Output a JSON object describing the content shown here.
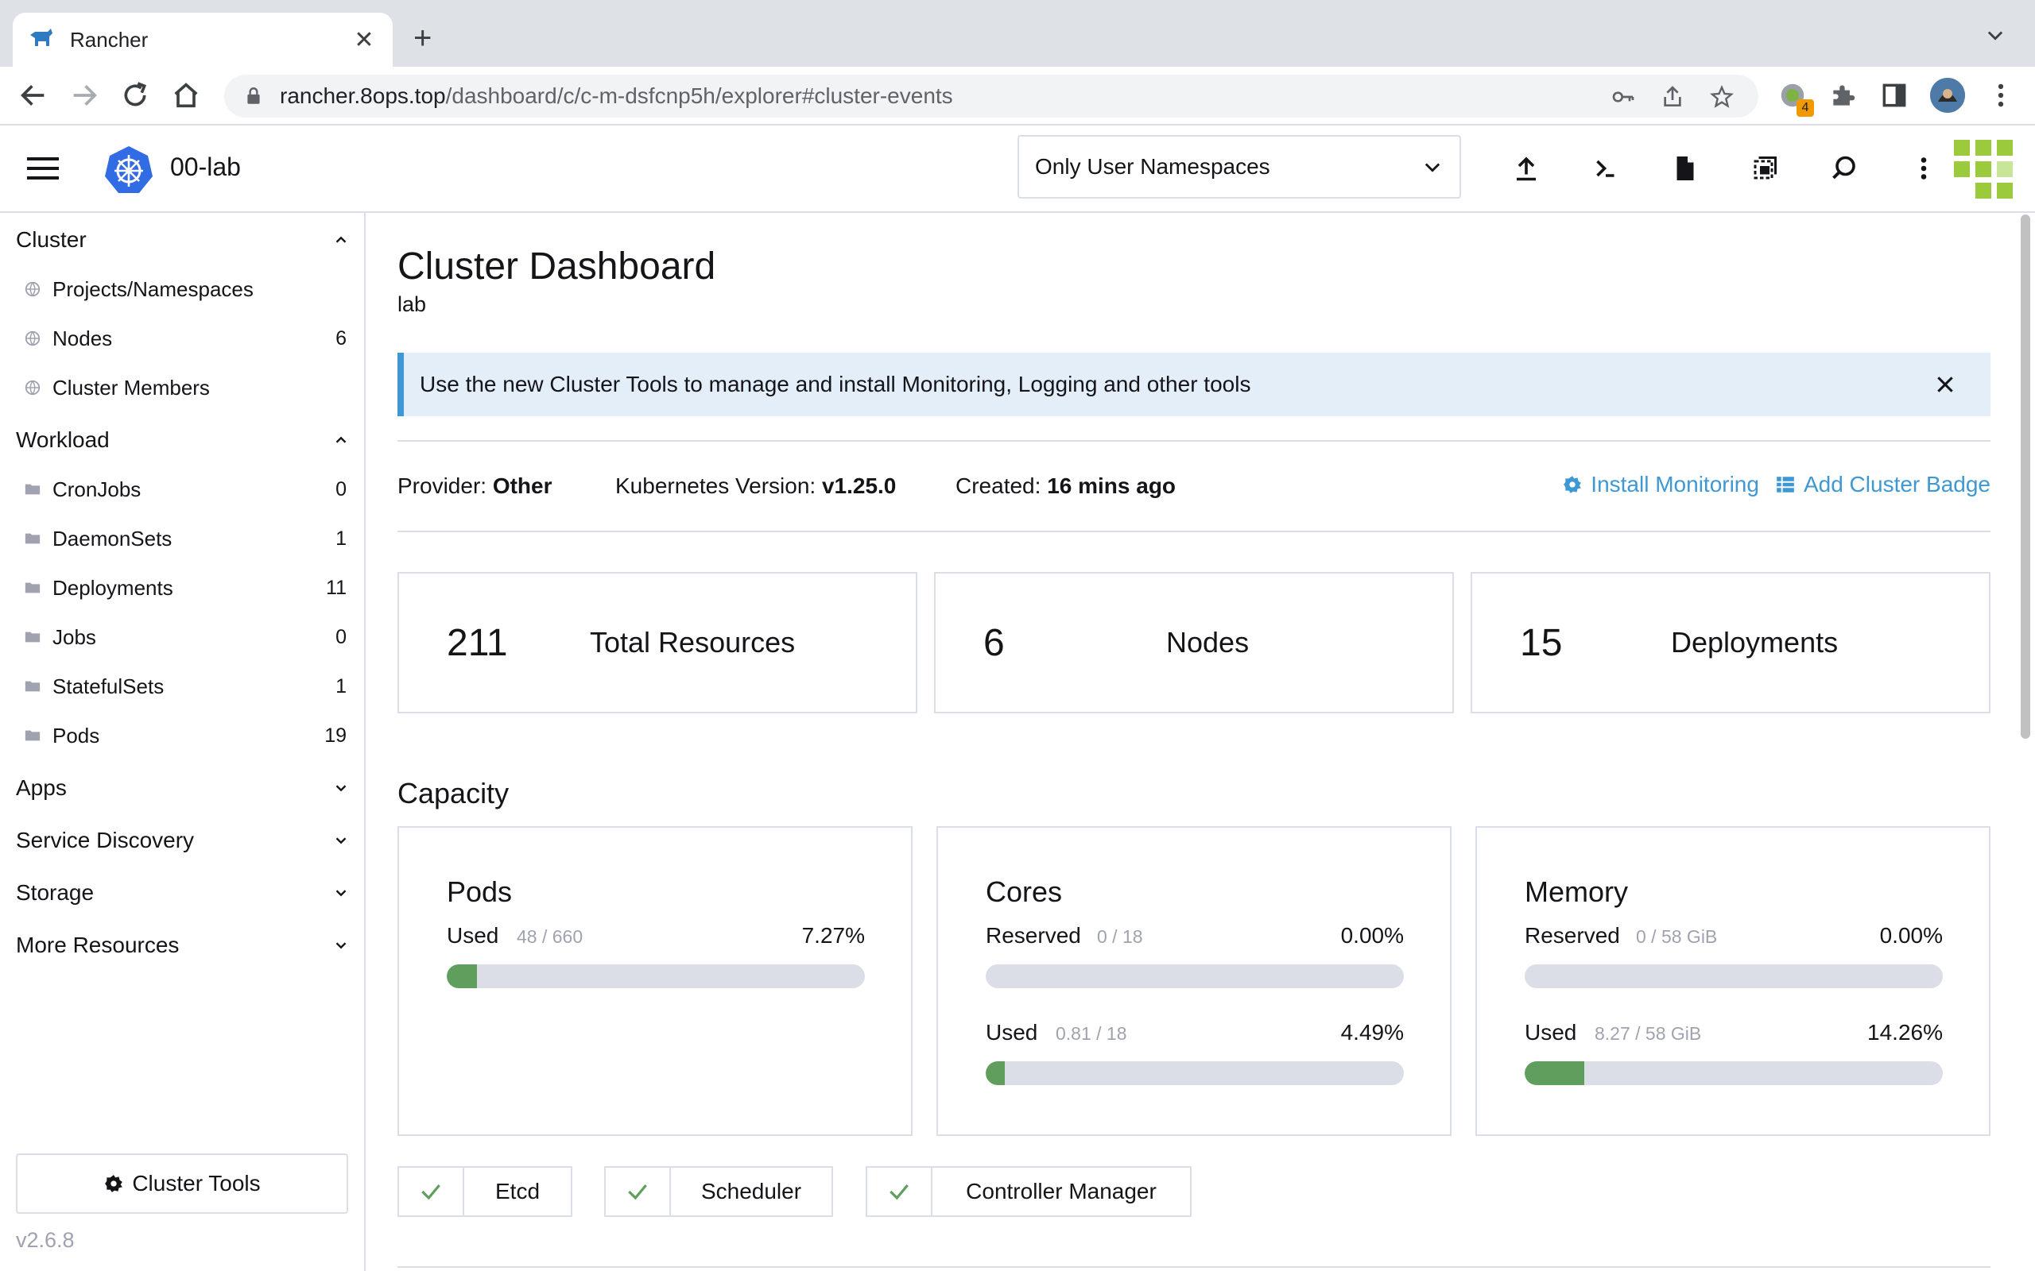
{
  "browser": {
    "tab_title": "Rancher",
    "url_host": "rancher.8ops.top",
    "url_path": "/dashboard/c/c-m-dsfcnp5h/explorer#cluster-events",
    "extension_badge": "4"
  },
  "header": {
    "cluster_name": "00-lab",
    "namespace_filter": "Only User Namespaces"
  },
  "sidebar": {
    "groups": {
      "cluster": "Cluster",
      "workload": "Workload",
      "apps": "Apps",
      "service_discovery": "Service Discovery",
      "storage": "Storage",
      "more_resources": "More Resources"
    },
    "cluster_items": [
      {
        "label": "Projects/Namespaces",
        "count": ""
      },
      {
        "label": "Nodes",
        "count": "6"
      },
      {
        "label": "Cluster Members",
        "count": ""
      }
    ],
    "workload_items": [
      {
        "label": "CronJobs",
        "count": "0"
      },
      {
        "label": "DaemonSets",
        "count": "1"
      },
      {
        "label": "Deployments",
        "count": "11"
      },
      {
        "label": "Jobs",
        "count": "0"
      },
      {
        "label": "StatefulSets",
        "count": "1"
      },
      {
        "label": "Pods",
        "count": "19"
      }
    ],
    "cluster_tools": "Cluster Tools",
    "version": "v2.6.8"
  },
  "main": {
    "title": "Cluster Dashboard",
    "subtitle": "lab",
    "banner": "Use the new Cluster Tools to manage and install Monitoring, Logging and other tools",
    "provider_label": "Provider:",
    "provider_value": "Other",
    "k8s_label": "Kubernetes Version:",
    "k8s_value": "v1.25.0",
    "created_label": "Created:",
    "created_value": "16 mins ago",
    "install_monitoring": "Install Monitoring",
    "add_cluster_badge": "Add Cluster Badge",
    "stats": [
      {
        "value": "211",
        "label": "Total Resources"
      },
      {
        "value": "6",
        "label": "Nodes"
      },
      {
        "value": "15",
        "label": "Deployments"
      }
    ],
    "capacity_title": "Capacity",
    "gauges": {
      "pods": {
        "title": "Pods",
        "used_label": "Used",
        "used_value": "48 / 660",
        "used_pct": "7.27%",
        "used_fraction": 0.0727
      },
      "cores": {
        "title": "Cores",
        "reserved_label": "Reserved",
        "reserved_value": "0 / 18",
        "reserved_pct": "0.00%",
        "reserved_fraction": 0,
        "used_label": "Used",
        "used_value": "0.81 / 18",
        "used_pct": "4.49%",
        "used_fraction": 0.0449
      },
      "memory": {
        "title": "Memory",
        "reserved_label": "Reserved",
        "reserved_value": "0 / 58 GiB",
        "reserved_pct": "0.00%",
        "reserved_fraction": 0,
        "used_label": "Used",
        "used_value": "8.27 / 58 GiB",
        "used_pct": "14.26%",
        "used_fraction": 0.1426
      }
    },
    "components": [
      "Etcd",
      "Scheduler",
      "Controller Manager"
    ]
  },
  "colors": {
    "accent": "#3d98d3",
    "success": "#5f9e5d",
    "border": "#dcdee7",
    "banner_bg": "#e3eef8",
    "muted": "#a0a2b0"
  }
}
